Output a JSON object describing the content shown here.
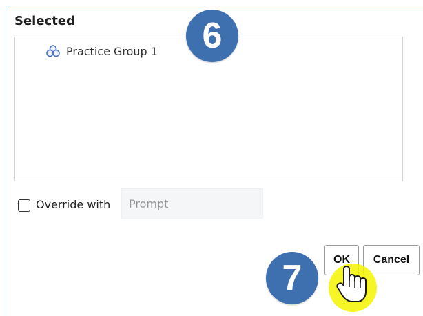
{
  "panel": {
    "heading": "Selected"
  },
  "selected_items": [
    {
      "label": "Practice Group 1",
      "icon": "group-icon"
    }
  ],
  "override": {
    "checked": false,
    "label": "Override with",
    "placeholder": "Prompt"
  },
  "buttons": {
    "ok": "OK",
    "cancel": "Cancel"
  },
  "annotations": {
    "step6": "6",
    "step7": "7"
  },
  "colors": {
    "badge": "#3e6fae",
    "highlight": "#f5f500",
    "group_icon": "#4a6fc7"
  }
}
